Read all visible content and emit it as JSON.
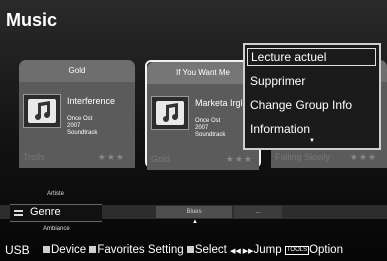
{
  "page": {
    "title": "Music"
  },
  "cards": [
    {
      "header": "Gold",
      "track": "Interference",
      "meta": [
        "Once Ost",
        "2007",
        "Soundtrack"
      ],
      "footer": "Trolls"
    },
    {
      "header": "If You Want Me",
      "track": "Marketa Irglova",
      "meta": [
        "Once Ost",
        "2007",
        "Soundtrack"
      ],
      "footer": "Gold"
    },
    {
      "header": "",
      "track": "",
      "meta": [
        "",
        "",
        ""
      ],
      "footer": "Falling Slowly"
    }
  ],
  "rating_stars": "★★★",
  "menu": {
    "items": [
      "Lecture actuel",
      "Supprimer",
      "Change Group Info",
      "Information"
    ],
    "selected_index": 0,
    "more_indicator": "▼"
  },
  "category_bar": {
    "selected": "Genre",
    "above": "Artiste",
    "below": "Ambiance",
    "segment_current": "Blues",
    "segment_next": "...",
    "position_marker": "▲"
  },
  "status": {
    "source": "USB",
    "device": "Device",
    "favorites": "Favorites Setting",
    "select": "Select",
    "jump_glyph": "◀◀ ▶▶",
    "jump": "Jump",
    "tools_key": "TOOLS",
    "option": "Option"
  },
  "colors": {
    "background": "#1a1a1a",
    "card": "#5b5b5b",
    "selected_border": "#f2f2f2"
  }
}
